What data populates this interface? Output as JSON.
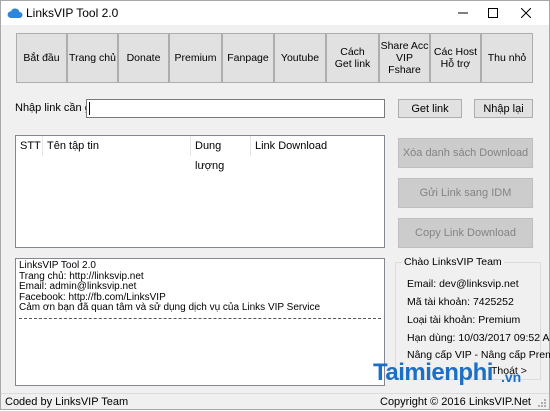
{
  "window": {
    "title": "LinksVIP Tool 2.0"
  },
  "toolbar": [
    {
      "label": "Bắt đầu"
    },
    {
      "label": "Trang chủ"
    },
    {
      "label": "Donate"
    },
    {
      "label": "Premium"
    },
    {
      "label": "Fanpage"
    },
    {
      "label": "Youtube"
    },
    {
      "label": "Cách\nGet link"
    },
    {
      "label": "Share Acc\nVIP Fshare"
    },
    {
      "label": "Các Host\nHỗ trợ"
    },
    {
      "label": "Thu nhỏ"
    }
  ],
  "link_input": {
    "label": "Nhập link cần get",
    "value": ""
  },
  "buttons": {
    "get_link": "Get link",
    "reset": "Nhập lại",
    "clear_download": "Xóa danh sách Download",
    "send_idm": "Gửi Link sang IDM",
    "copy_link": "Copy Link Download"
  },
  "list": {
    "columns": [
      "STT",
      "Tên tập tin",
      "Dung lượng",
      "Link Download"
    ]
  },
  "log": {
    "lines": [
      "LinksVIP Tool 2.0",
      "Trang chủ: http://linksvip.net",
      "Email: admin@linksvip.net",
      "Facebook: http://fb.com/LinksVIP",
      "Cảm ơn bạn đã quan tâm và sử dụng dịch vụ của Links VIP Service"
    ]
  },
  "account": {
    "legend": "Chào LinksVIP Team",
    "email": "Email: dev@linksvip.net",
    "account_id": "Mã tài khoản: 7425252",
    "account_type": "Loại tài khoản: Premium",
    "expiry": "Hạn dùng: 10/03/2017 09:52 AM",
    "upgrade": "Nâng cấp VIP - Nâng cấp Premium",
    "exit": "Thoát >"
  },
  "status": {
    "left": "Coded by LinksVIP Team",
    "right": "Copyright © 2016 LinksVIP.Net"
  },
  "watermark": {
    "text": "Taimienphi",
    "suffix": ".vn"
  },
  "colors": {
    "accent_blue": "#1e88e5",
    "watermark_blue": "#1c6fc4",
    "watermark_red": "#e53935"
  }
}
